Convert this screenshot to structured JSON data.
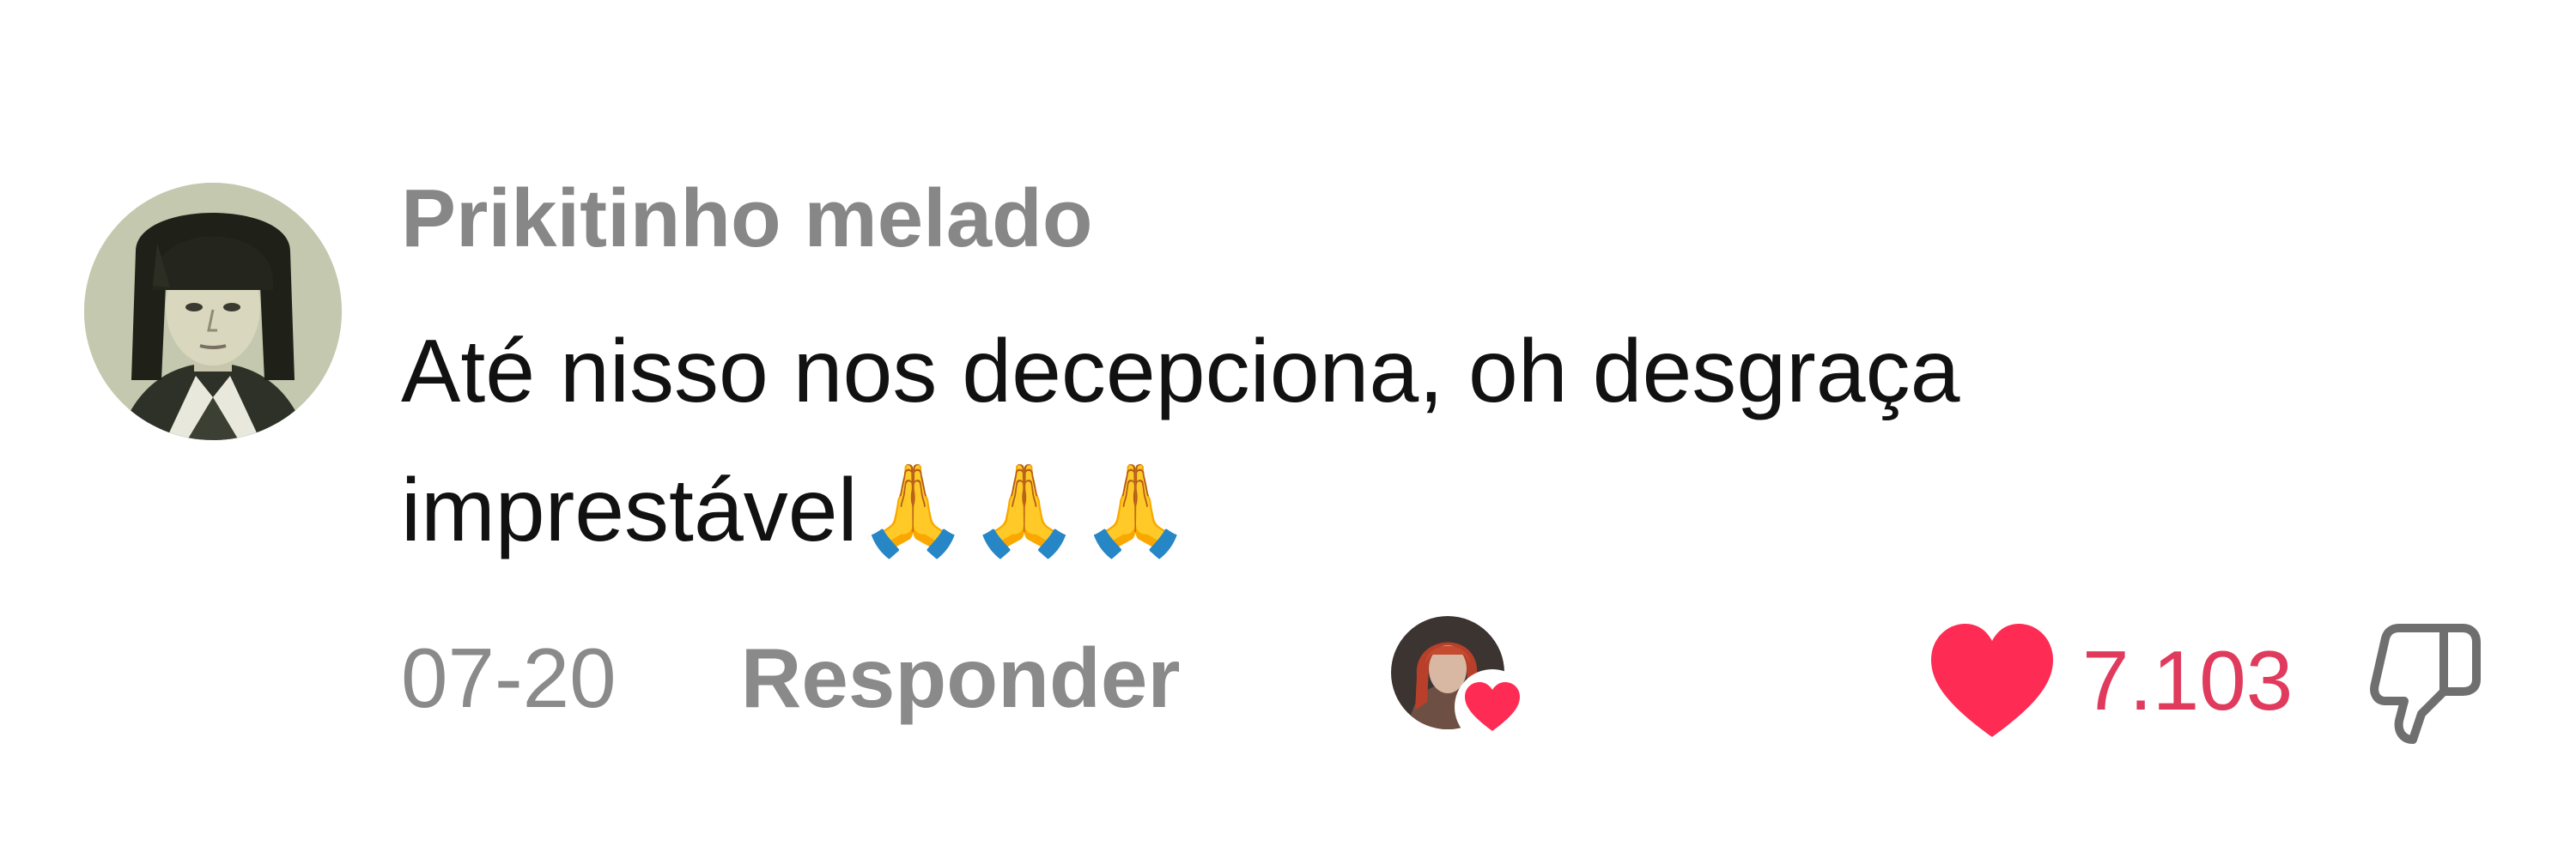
{
  "comment": {
    "username": "Prikitinho melado",
    "text": "Até nisso nos decepciona, oh desgraça imprestável🙏🙏🙏",
    "date": "07-20",
    "reply_label": "Responder",
    "like_count": "7.103",
    "liked_by_creator": true,
    "liked": true
  },
  "icons": {
    "avatar": "user-avatar-photo",
    "creator_avatar": "creator-avatar-photo",
    "creator_heart": "heart-icon",
    "like": "heart-icon",
    "dislike": "thumbs-down-icon"
  },
  "colors": {
    "like_red": "#fe2c55",
    "like_count": "#e03a5d",
    "muted_text": "#8a8a8a",
    "body_text": "#111111"
  }
}
